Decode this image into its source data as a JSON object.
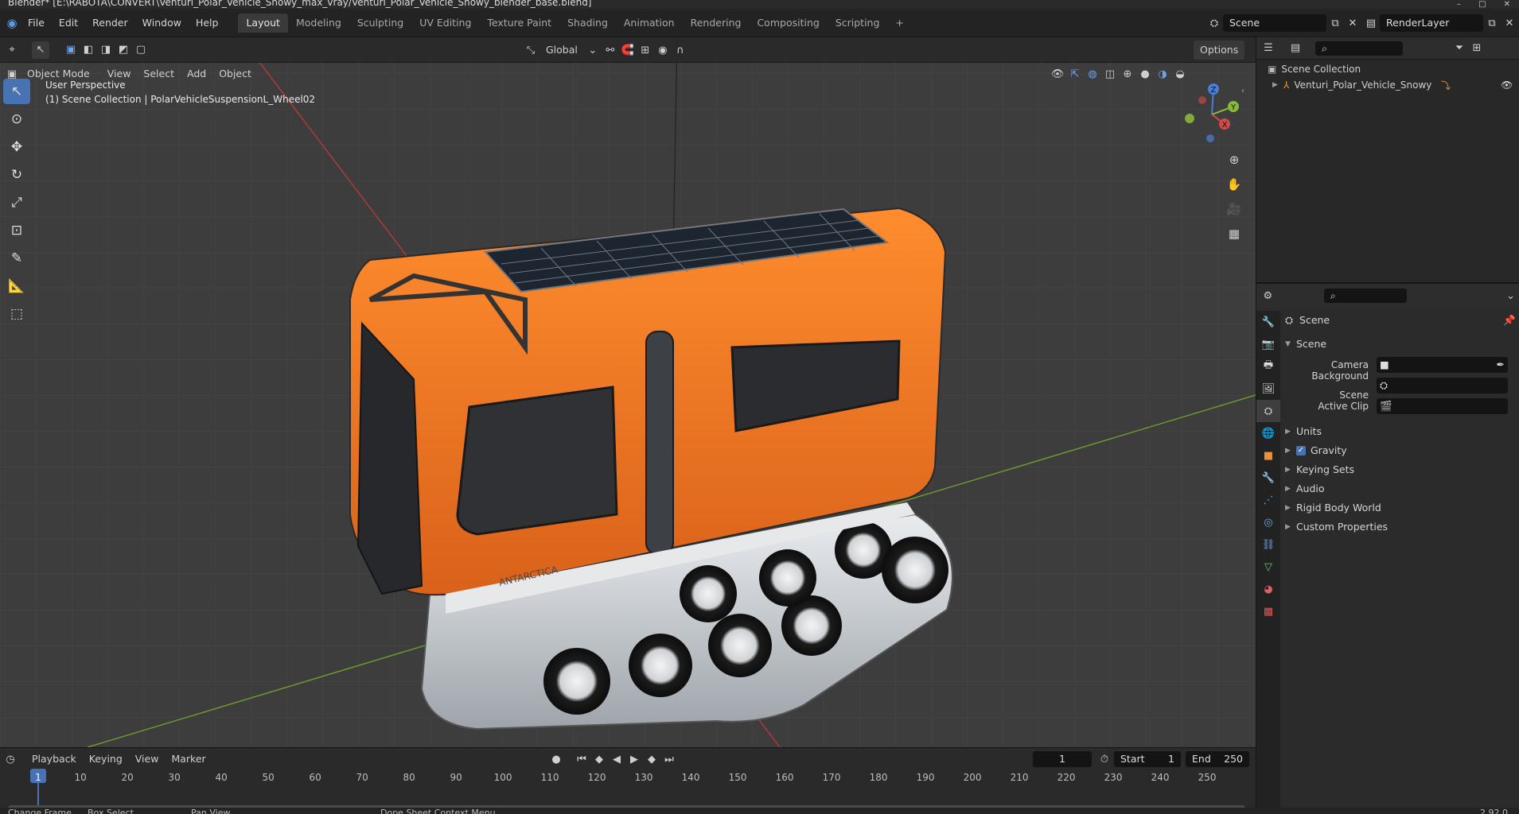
{
  "window": {
    "title": "Blender* [E:\\RABOTA\\CONVERT\\Venturi_Polar_Vehicle_Snowy_max_vray/Venturi_Polar_Vehicle_Snowy_blender_base.blend]"
  },
  "menus": [
    "File",
    "Edit",
    "Render",
    "Window",
    "Help"
  ],
  "workspaces": [
    {
      "label": "Layout",
      "active": true
    },
    {
      "label": "Modeling"
    },
    {
      "label": "Sculpting"
    },
    {
      "label": "UV Editing"
    },
    {
      "label": "Texture Paint"
    },
    {
      "label": "Shading"
    },
    {
      "label": "Animation"
    },
    {
      "label": "Rendering"
    },
    {
      "label": "Compositing"
    },
    {
      "label": "Scripting"
    }
  ],
  "scene_field": "Scene",
  "view_layer_field": "RenderLayer",
  "viewport": {
    "mode": "Object Mode",
    "menus": [
      "View",
      "Select",
      "Add",
      "Object"
    ],
    "transform_orientation": "Global",
    "options_label": "Options",
    "overlay_title": "User Perspective",
    "overlay_subtitle": "(1) Scene Collection | PolarVehicleSuspensionL_Wheel02",
    "gizmo": {
      "z": "Z",
      "y": "Y",
      "x": "X"
    },
    "vehicle_label": "ANTARCTICA"
  },
  "outliner": {
    "root": "Scene Collection",
    "items": [
      {
        "label": "Venturi_Polar_Vehicle_Snowy"
      }
    ]
  },
  "properties": {
    "header": "Scene",
    "section": "Scene",
    "fields": [
      {
        "label": "Camera"
      },
      {
        "label": "Background Scene"
      },
      {
        "label": "Active Clip"
      }
    ],
    "panels": [
      {
        "label": "Units",
        "checkbox": false
      },
      {
        "label": "Gravity",
        "checkbox": true
      },
      {
        "label": "Keying Sets",
        "checkbox": false
      },
      {
        "label": "Audio",
        "checkbox": false
      },
      {
        "label": "Rigid Body World",
        "checkbox": false
      },
      {
        "label": "Custom Properties",
        "checkbox": false
      }
    ]
  },
  "timeline": {
    "menus": [
      "Playback",
      "Keying",
      "View",
      "Marker"
    ],
    "current_frame": "1",
    "start_label": "Start",
    "start": "1",
    "end_label": "End",
    "end": "250",
    "ticks": [
      "1",
      "10",
      "20",
      "30",
      "40",
      "50",
      "60",
      "70",
      "80",
      "90",
      "100",
      "110",
      "120",
      "130",
      "140",
      "150",
      "160",
      "170",
      "180",
      "190",
      "200",
      "210",
      "220",
      "230",
      "240",
      "250"
    ]
  },
  "statusbar": {
    "items": [
      "Change Frame",
      "Box Select",
      "Pan View",
      "Dope Sheet Context Menu"
    ],
    "version": "2.92.0"
  },
  "colors": {
    "accent": "#4772b3",
    "vehicle": "#f07a1e",
    "x_axis": "#b03a3a",
    "y_axis": "#6b9a2d"
  }
}
